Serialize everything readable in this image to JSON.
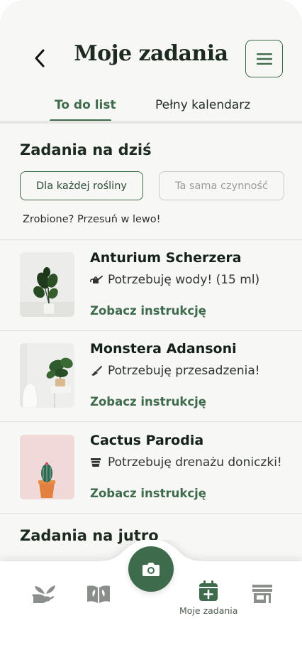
{
  "header": {
    "title": "Moje zadania",
    "back_icon": "chevron-left-icon",
    "menu_icon": "hamburger-menu-icon"
  },
  "tabs": [
    {
      "label": "To do list",
      "active": true
    },
    {
      "label": "Pełny kalendarz",
      "active": false
    }
  ],
  "today": {
    "title": "Zadania na dziś",
    "filters": [
      {
        "label": "Dla każdej rośliny",
        "active": true
      },
      {
        "label": "Ta sama czynność",
        "active": false
      }
    ],
    "hint": "Zrobione? Przesuń w lewo!",
    "tasks": [
      {
        "name": "Anturium Scherzera",
        "need": "Potrzebuję wody! (15 ml)",
        "need_icon": "watering-can-icon",
        "link": "Zobacz instrukcję"
      },
      {
        "name": "Monstera Adansoni",
        "need": "Potrzebuję przesadzenia!",
        "need_icon": "trowel-icon",
        "link": "Zobacz instrukcję"
      },
      {
        "name": "Cactus Parodia",
        "need": "Potrzebuję drenażu doniczki!",
        "need_icon": "drainage-icon",
        "link": "Zobacz instrukcję"
      }
    ]
  },
  "tomorrow": {
    "title": "Zadania na jutro"
  },
  "bottom_nav": {
    "items": [
      {
        "icon": "plant-hand-icon",
        "label": ""
      },
      {
        "icon": "book-leaf-icon",
        "label": ""
      },
      {
        "icon": "camera-icon",
        "label": ""
      },
      {
        "icon": "calendar-plus-icon",
        "label": "Moje zadania",
        "active": true
      },
      {
        "icon": "store-icon",
        "label": ""
      }
    ]
  },
  "colors": {
    "accent": "#3e6b4c",
    "background": "#f7f7f5",
    "inactive_border": "#c9ccc6"
  }
}
